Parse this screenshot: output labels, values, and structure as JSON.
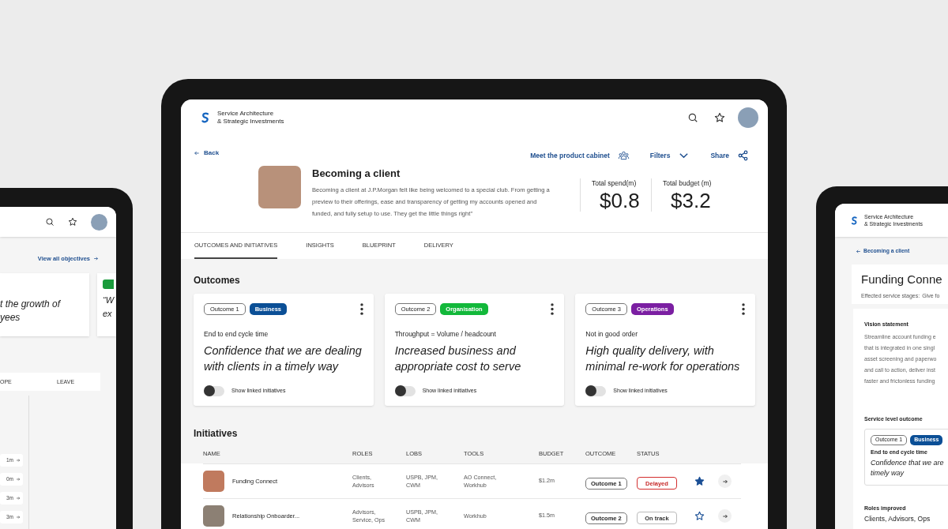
{
  "left_device": {
    "view_all_link": "View all objectives",
    "objective_quote_lines": [
      "t the growth of",
      "yees"
    ],
    "next_quote_lines": [
      "“W",
      "ex"
    ],
    "table_columns": [
      "OPE",
      "LEAVE"
    ],
    "amounts": [
      "1m",
      "0m",
      "3m",
      "3m"
    ]
  },
  "main_device": {
    "app_title_lines": [
      "Service Architecture",
      "& Strategic Investments"
    ],
    "back": "Back",
    "actions": [
      {
        "label": "Meet the product cabinet"
      },
      {
        "label": "Filters"
      },
      {
        "label": "Share"
      }
    ],
    "journey": {
      "title": "Becoming a client",
      "description": "Becoming a client  at J.P.Morgan felt like being welcomed to a special club. From getting a preview to their offerings, ease and transparency of getting my accounts opened and funded, and fully setup to use. They get the little things right”",
      "stats": [
        {
          "label": "Total spend(m)",
          "value": "$0.8"
        },
        {
          "label": "Total budget (m)",
          "value": "$3.2"
        }
      ]
    },
    "tabs": [
      {
        "label": "OUTCOMES AND INITIATIVES",
        "selected": true
      },
      {
        "label": "INSIGHTS",
        "selected": false
      },
      {
        "label": "BLUEPRINT",
        "selected": false
      },
      {
        "label": "DELIVERY",
        "selected": false
      }
    ],
    "outcomes": {
      "heading": "Outcomes",
      "cards": [
        {
          "number": "Outcome 1",
          "category": "Business",
          "color": "#0b4f96",
          "metric": "End to end cycle time",
          "statement": "Confidence that we are dealing with clients in a timely way",
          "toggle_label": "Show linked initiatives",
          "on": false
        },
        {
          "number": "Outcome 2",
          "category": "Organisation",
          "color": "#12b83a",
          "metric": "Throughput = Volume / headcount",
          "statement": "Increased business and appropriate cost to serve",
          "toggle_label": "Show linked initiatives",
          "on": false
        },
        {
          "number": "Outcome 3",
          "category": "Operations",
          "color": "#7b1fa2",
          "metric": "Not in good order",
          "statement": "High quality delivery, with minimal re-work for operations",
          "toggle_label": "Show linked initiatives",
          "on": false
        }
      ]
    },
    "initiatives": {
      "heading": "Initiatives",
      "columns": [
        "NAME",
        "ROLES",
        "LOBS",
        "TOOLS",
        "BUDGET",
        "OUTCOME",
        "STATUS"
      ],
      "rows": [
        {
          "name": "Funding Connect",
          "roles": "Clients, Advisors",
          "lobs": "USPB, JPM, CWM",
          "tools": "AO Connect, Workhub",
          "budget": "$1.2m",
          "outcome": "Outcome 1",
          "status": "Delayed",
          "kind": "alert",
          "starred": true
        },
        {
          "name": "Relationship Onboarder...",
          "roles": "Advisors, Service, Ops",
          "lobs": "USPB, JPM, CWM",
          "tools": "Workhub",
          "budget": "$1.5m",
          "outcome": "Outcome 2",
          "status": "On track",
          "kind": "normal",
          "starred": false
        }
      ]
    }
  },
  "right_device": {
    "app_title_lines": [
      "Service Architecture",
      "& Strategic Investments"
    ],
    "back": "Becoming a client",
    "title": "Funding Conne",
    "stages_label": "Effected service stages:",
    "stages_value": "Give fo",
    "vision_heading": "Vision statement",
    "vision_lines": [
      "Streamline account funding e",
      "that is integrated in one singl",
      "asset screening and paperwo",
      "and call to action, deliver inst",
      "faster and frictonless funding"
    ],
    "outcome_heading": "Service level outcome",
    "outcome": {
      "number": "Outcome 1",
      "category": "Business",
      "color": "#0b4f96",
      "metric": "End to end cycle time",
      "statement_lines": [
        "Confidence that we are",
        "timely way"
      ]
    },
    "roles_heading": "Roles improved",
    "roles": "Clients, Advisors, Ops"
  }
}
